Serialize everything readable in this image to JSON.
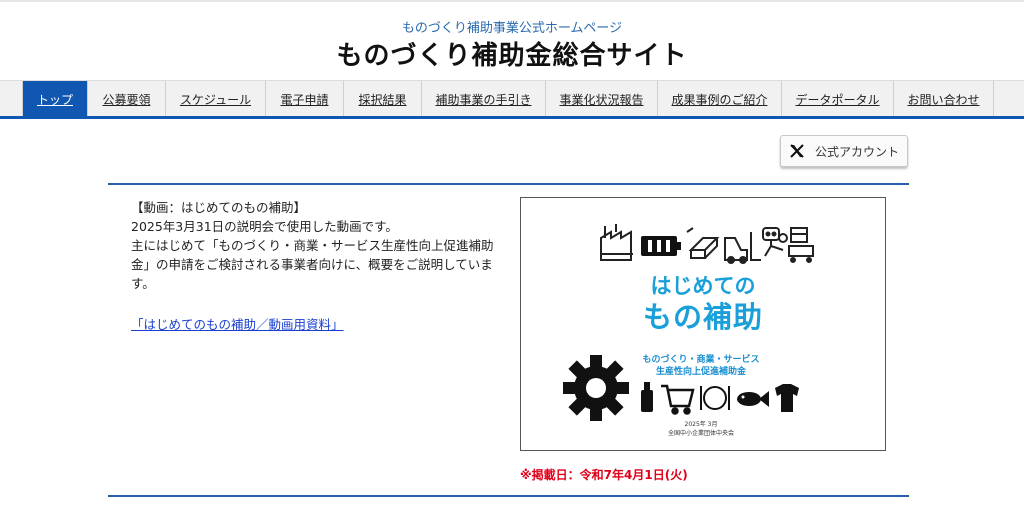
{
  "header": {
    "subtitle": "ものづくり補助事業公式ホームページ",
    "title": "ものづくり補助金総合サイト"
  },
  "nav": {
    "items": [
      {
        "label": "トップ",
        "active": true
      },
      {
        "label": "公募要領"
      },
      {
        "label": "スケジュール"
      },
      {
        "label": "電子申請"
      },
      {
        "label": "採択結果"
      },
      {
        "label": "補助事業の手引き"
      },
      {
        "label": "事業化状況報告"
      },
      {
        "label": "成果事例のご紹介"
      },
      {
        "label": "データポータル"
      },
      {
        "label": "お問い合わせ"
      }
    ]
  },
  "social": {
    "x_label": "公式アカウント",
    "icon": "x-logo-icon"
  },
  "article": {
    "heading": "【動画：はじめてのもの補助】",
    "line1": "2025年3月31日の説明会で使用した動画です。",
    "line2": "主にはじめて「ものづくり・商業・サービス生産性向上促進補助金」の申請をご検討される事業者向けに、概要をご説明しています。",
    "link": "「はじめてのもの補助／動画用資料」"
  },
  "thumbnail": {
    "title_line1": "はじめての",
    "title_line2": "もの補助",
    "sub_line1": "ものづくり・商業・サービス",
    "sub_line2": "生産性向上促進補助金",
    "date": "2025年 3月",
    "org": "全国中小企業団体中央会"
  },
  "posted": "※掲載日：令和7年4月1日(火)",
  "colors": {
    "brand_blue": "#0f57b0",
    "accent_cyan": "#1aa0d8",
    "alert_red": "#e0001a"
  }
}
